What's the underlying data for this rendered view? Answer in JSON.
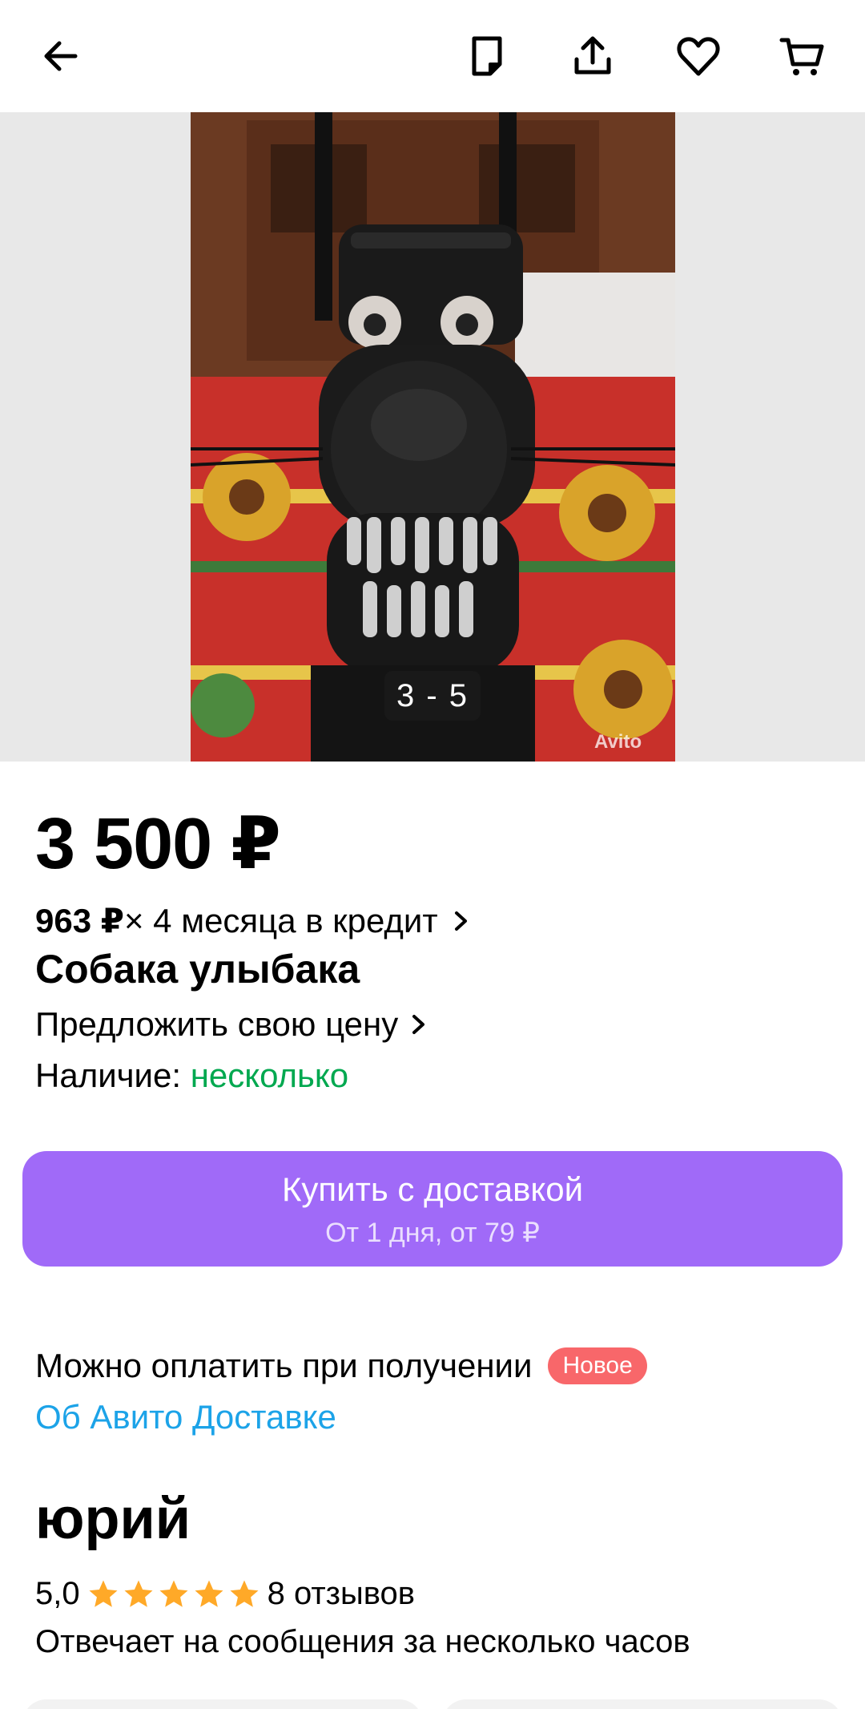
{
  "topbar": {
    "icons": [
      "back-arrow-icon",
      "note-icon",
      "share-icon",
      "heart-icon",
      "cart-icon"
    ]
  },
  "gallery": {
    "counter": "3 - 5",
    "watermark": "Avito"
  },
  "listing": {
    "price": "3 500 ₽",
    "credit_amount": "963 ₽",
    "credit_text": " × 4 месяца в кредит",
    "title": "Собака улыбака",
    "offer_price": "Предложить свою цену",
    "stock_label": "Наличие: ",
    "stock_value": "несколько"
  },
  "buy_button": {
    "label": "Купить с доставкой",
    "sublabel": "От 1 дня, от 79 ₽"
  },
  "payment": {
    "text": "Можно оплатить при получении",
    "badge": "Новое",
    "link": "Об Авито Доставке"
  },
  "seller": {
    "name": "юрий",
    "rating": "5,0",
    "stars": 5,
    "reviews": "8 отзывов",
    "response": "Отвечает на сообщения за несколько часов"
  },
  "colors": {
    "accent_purple": "#a06af8",
    "stock_green": "#00a84f",
    "link_blue": "#1ca3e8",
    "badge_red": "#f8676a",
    "star_orange": "#ffa928"
  }
}
